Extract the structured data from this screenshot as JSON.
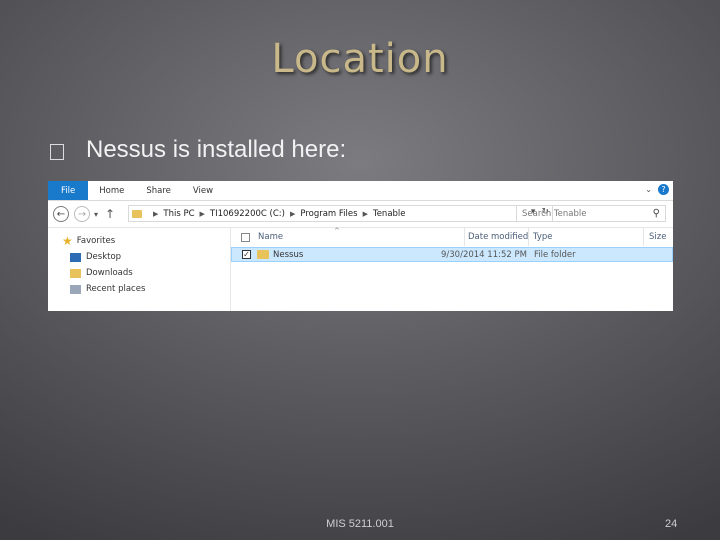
{
  "slide": {
    "title": "Location",
    "bullet": "Nessus is installed here:",
    "footer": "MIS 5211.001",
    "page_number": "24",
    "title_color": "#c8b88a"
  },
  "explorer": {
    "ribbon_tabs": [
      "File",
      "Home",
      "Share",
      "View"
    ],
    "address": [
      "This PC",
      "TI10692200C (C:)",
      "Program Files",
      "Tenable"
    ],
    "search_placeholder": "Search Tenable",
    "nav_pane": {
      "favorites": "Favorites",
      "items": [
        "Desktop",
        "Downloads",
        "Recent places"
      ]
    },
    "columns": [
      "Name",
      "Date modified",
      "Type",
      "Size"
    ],
    "rows": [
      {
        "name": "Nessus",
        "date": "9/30/2014 11:52 PM",
        "type": "File folder",
        "size": ""
      }
    ],
    "accent_color": "#1979ca",
    "selection_color": "#cce8ff",
    "icons": [
      "back-icon",
      "forward-icon",
      "up-icon",
      "refresh-icon",
      "search-icon",
      "star-icon",
      "folder-icon",
      "help-icon"
    ]
  }
}
